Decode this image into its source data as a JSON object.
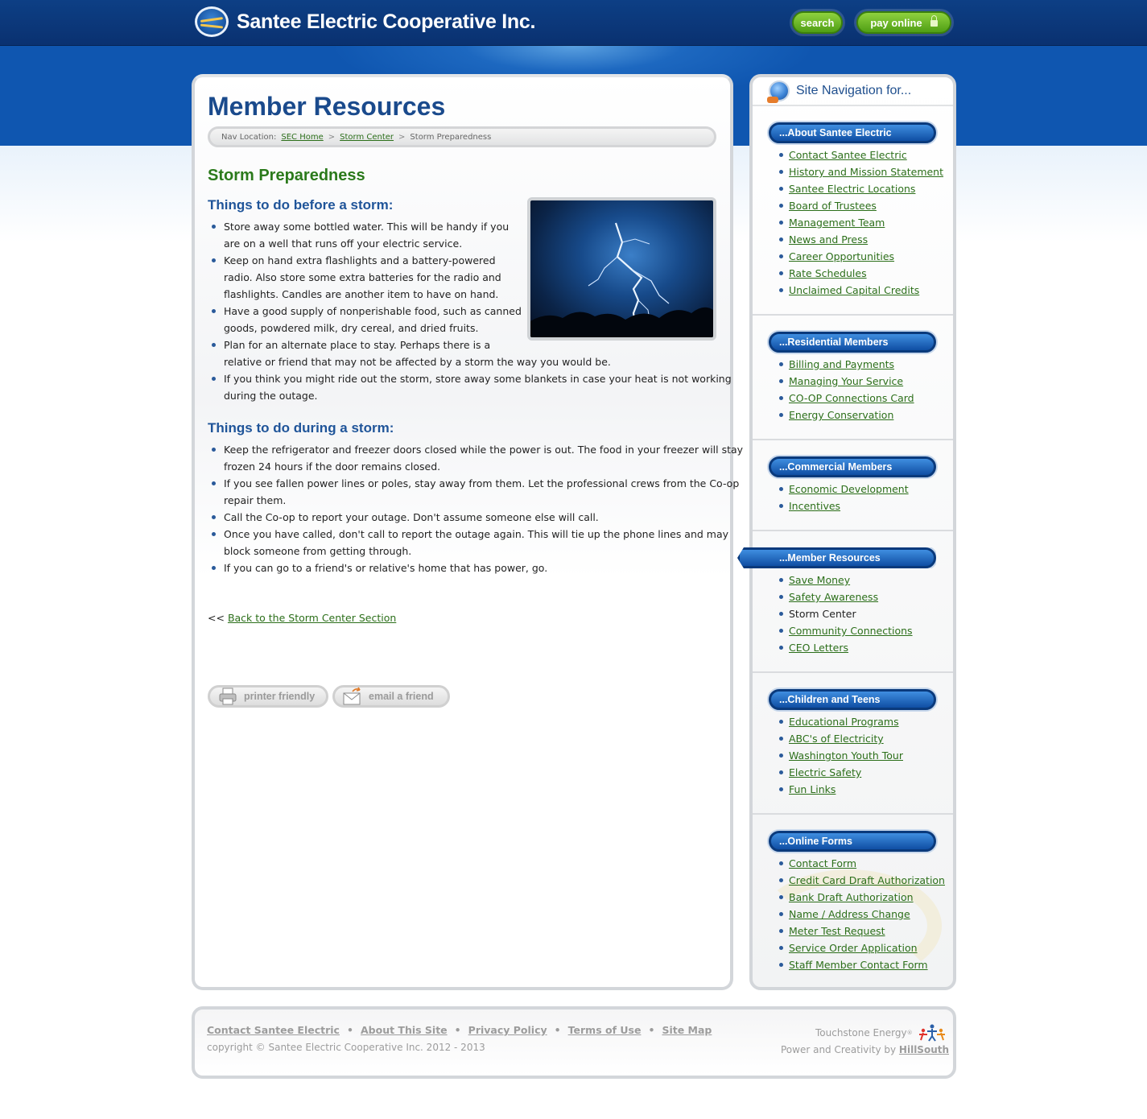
{
  "header": {
    "site_title": "Santee Electric Cooperative Inc.",
    "search_label": "search",
    "pay_label": "pay online"
  },
  "main": {
    "page_title": "Member Resources",
    "breadcrumb": {
      "prefix": "Nav Location:",
      "items": [
        "SEC Home",
        "Storm Center"
      ],
      "current": "Storm Preparedness",
      "separator": ">"
    },
    "section_title": "Storm Preparedness",
    "before_heading": "Things to do before a storm:",
    "before_items": [
      [
        "Store away some bottled water. This will be handy if you",
        "are on a well that runs off your electric service."
      ],
      [
        "Keep on hand extra flashlights and a battery-powered",
        "radio. Also store some extra batteries for the radio and",
        "flashlights. Candles are another item to have on hand."
      ],
      [
        "Have a good supply of nonperishable food, such as canned",
        "goods, powdered milk, dry cereal, and dried fruits."
      ],
      [
        "Plan for an alternate place to stay. Perhaps there is a",
        "relative or friend that may not be affected by a storm the way you would be."
      ],
      [
        "If you think you might ride out the storm, store away some blankets in case your heat is not working",
        "during the outage."
      ]
    ],
    "during_heading": "Things to do during a storm:",
    "during_items": [
      [
        "Keep the refrigerator and freezer doors closed while the power is out. The food in your freezer will stay",
        "frozen 24 hours if the door remains closed."
      ],
      [
        "If you see fallen power lines or poles, stay away from them. Let the professional crews from the Co-op",
        "repair them."
      ],
      [
        "Call the Co-op to report your outage. Don't assume someone else will call."
      ],
      [
        "Once you have called, don't call to report the outage again. This will tie up the phone lines and may",
        "block someone from getting through."
      ],
      [
        "If you can go to a friend's or relative's home that has power, go."
      ]
    ],
    "back_prefix": "<<",
    "back_link": "Back to the Storm Center Section",
    "printer_label": "printer friendly",
    "email_label": "email a friend"
  },
  "sidebar": {
    "heading": "Site Navigation for...",
    "sections": [
      {
        "title": "...About Santee Electric",
        "items": [
          "Contact Santee Electric",
          "History and Mission Statement",
          "Santee Electric Locations",
          "Board of Trustees",
          "Management Team",
          "News and Press",
          "Career Opportunities",
          "Rate Schedules",
          "Unclaimed Capital Credits"
        ]
      },
      {
        "title": "...Residential Members",
        "items": [
          "Billing and Payments",
          "Managing Your Service",
          "CO-OP Connections Card",
          "Energy Conservation"
        ]
      },
      {
        "title": "...Commercial Members",
        "items": [
          "Economic Development",
          "Incentives"
        ]
      },
      {
        "title": "...Member Resources",
        "items": [
          "Save Money",
          "Safety Awareness",
          "Storm Center",
          "Community Connections",
          "CEO Letters"
        ],
        "current_item": "Storm Center"
      },
      {
        "title": "...Children and Teens",
        "items": [
          "Educational Programs",
          "ABC's of Electricity",
          "Washington Youth Tour",
          "Electric Safety",
          "Fun Links"
        ]
      },
      {
        "title": "...Online Forms",
        "items": [
          "Contact Form",
          "Credit Card Draft Authorization",
          "Bank Draft Authorization",
          "Name / Address Change",
          "Meter Test Request",
          "Service Order Application",
          "Staff Member Contact Form"
        ]
      }
    ]
  },
  "footer": {
    "links": [
      "Contact Santee Electric",
      "About This Site",
      "Privacy Policy",
      "Terms of Use",
      "Site Map"
    ],
    "copyright": "copyright © Santee Electric Cooperative Inc. 2012 - 2013",
    "touchstone": "Touchstone Energy",
    "touchstone_mark": "®",
    "powered_prefix": "Power and Creativity by",
    "powered_link": "HillSouth"
  },
  "colors": {
    "header_blue": "#0d3f85",
    "title_blue": "#1a4a8c",
    "section_green": "#2b7a1b",
    "link_green": "#2c6f1a",
    "button_green": "#6ab82a"
  }
}
